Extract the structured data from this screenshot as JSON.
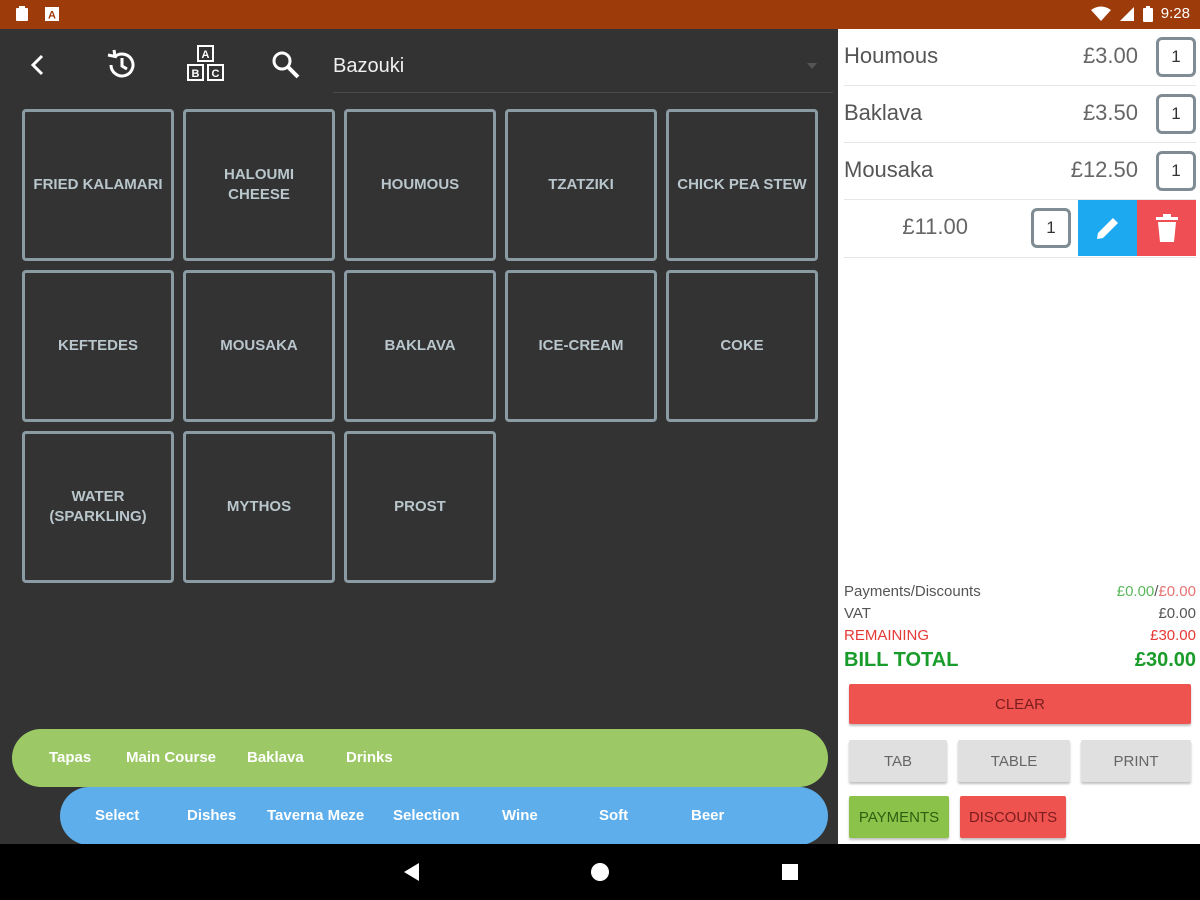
{
  "status_bar": {
    "time": "9:28"
  },
  "toolbar": {
    "search_value": "Bazouki"
  },
  "products": [
    "FRIED KALAMARI",
    "HALOUMI CHEESE",
    "HOUMOUS",
    "TZATZIKI",
    "CHICK PEA STEW",
    "KEFTEDES",
    "MOUSAKA",
    "BAKLAVA",
    "ICE-CREAM",
    "COKE",
    "WATER (SPARKLING)",
    "MYTHOS",
    "PROST"
  ],
  "categories": [
    "Tapas",
    "Main Course",
    "Baklava",
    "Drinks"
  ],
  "subcategories": [
    "Select",
    "Dishes",
    "Taverna Meze",
    "Selection",
    "Wine",
    "Soft",
    "Beer"
  ],
  "order": {
    "items": [
      {
        "name": "Houmous",
        "price": "£3.00",
        "qty": "1"
      },
      {
        "name": "Baklava",
        "price": "£3.50",
        "qty": "1"
      },
      {
        "name": "Mousaka",
        "price": "£12.50",
        "qty": "1"
      }
    ],
    "selected": {
      "price": "£11.00",
      "qty": "1"
    }
  },
  "totals": {
    "payments_label": "Payments/Discounts",
    "payments_value": "£0.00",
    "discounts_value": "£0.00",
    "vat_label": "VAT",
    "vat_value": "£0.00",
    "remaining_label": "REMAINING",
    "remaining_value": "£30.00",
    "bill_total_label": "BILL TOTAL",
    "bill_total_value": "£30.00"
  },
  "actions": {
    "clear": "CLEAR",
    "tab": "TAB",
    "table": "TABLE",
    "print": "PRINT",
    "payments": "PAYMENTS",
    "discounts": "DISCOUNTS"
  },
  "colors": {
    "status_bar": "#9e3b0a",
    "category_bar": "#9cc966",
    "subcategory_bar": "#5daeeb",
    "edit": "#1da9f0",
    "delete": "#ef4e55",
    "green_text": "#1a9c2a",
    "red_text": "#e53935"
  }
}
